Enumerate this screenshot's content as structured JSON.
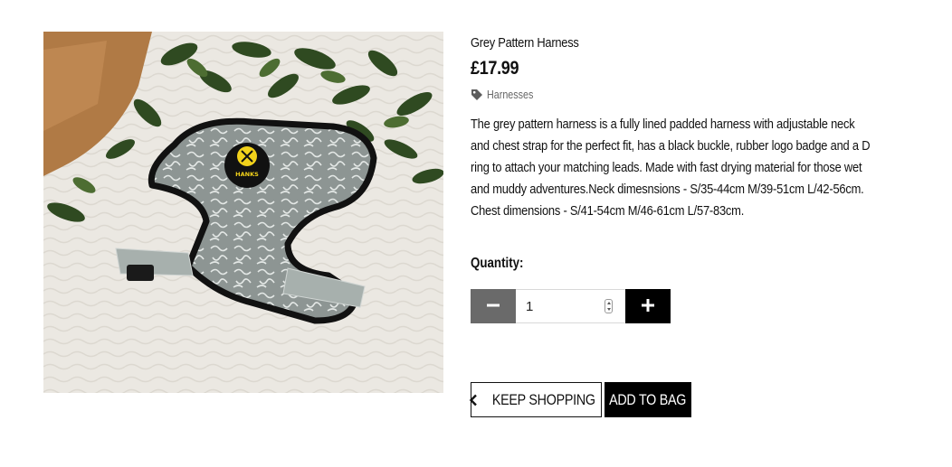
{
  "product": {
    "title": "Grey Pattern Harness",
    "price": "£17.99",
    "category": "Harnesses",
    "description": "The grey pattern harness is a fully lined padded harness with adjustable neck and chest strap for the perfect fit, has a black buckle, rubber logo badge and a D ring to attach your matching leads. Made with fast drying material for those wet and muddy adventures.Neck dimesnsions - S/35-44cm M/39-51cm L/42-56cm. Chest dimensions - S/41-54cm M/46-61cm L/57-83cm.",
    "image_badge_text": "HANKS"
  },
  "quantity": {
    "label": "Quantity:",
    "value": "1"
  },
  "buttons": {
    "keep_shopping": "KEEP SHOPPING",
    "add_to_bag": "ADD TO BAG"
  },
  "icons": {
    "category": "tag-icon",
    "minus": "minus-icon",
    "plus": "plus-icon",
    "keep_shopping": "chevron-left-icon"
  },
  "colors": {
    "minus_button": "#6a6a6a",
    "plus_button": "#000000",
    "add_to_bag_bg": "#000000",
    "category_text": "#666666"
  }
}
